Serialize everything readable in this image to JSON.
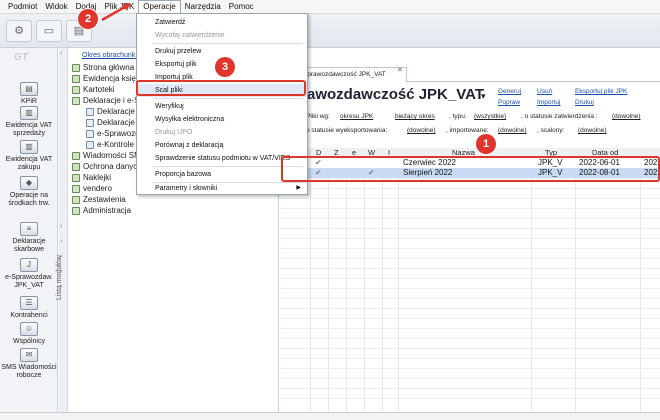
{
  "menubar": [
    "Podmiot",
    "Widok",
    "Dodaj",
    "Plik JPK",
    "Operacje",
    "Narzędzia",
    "Pomoc"
  ],
  "sidebar": {
    "items": [
      "KPiR",
      "Ewidencja VAT sprzedaży",
      "Ewidencja VAT zakupu",
      "Operacje na środkach trw.",
      "Deklaracje skarbowe",
      "e-Sprawozdaw. JPK_VAT",
      "Kontrahenci",
      "Wspólnicy",
      "SMS Wiadomości robocze"
    ],
    "modules_label": "Lista modułów"
  },
  "tree": {
    "period_link": "Okres obrachunk...",
    "items": [
      "Strona główna",
      "Ewidencja księg...",
      "Kartoteki",
      "Deklaracje i e-S...",
      "Deklaracje s...",
      "Deklaracje z...",
      "e-Sprawozd...",
      "e-Kontrole ...",
      "Wiadomości SM...",
      "Ochrona danyc...",
      "Naklejki",
      "vendero",
      "Zestawienia",
      "Administracja"
    ]
  },
  "main": {
    "tab_label": "sprawozdawczość JPK_VAT",
    "title": "Sprawozdawczość JPK_VAT",
    "actions": [
      "Generuj",
      "Usuń",
      "Eksportuj plik JPK",
      "Popraw",
      "Importuj",
      "Drukuj"
    ],
    "filters": {
      "by_label": "Pliki wg:",
      "by_value": "okresu JPK",
      "period_value": "bieżący okres",
      "type_label": ", typu:",
      "type_value": "(wszystkie)",
      "approval_label": ", o statusie zatwierdzenia :",
      "approval_value": "(dowolne)",
      "export_label": "o statusie wyeksportowania:",
      "export_value": "(dowolne)",
      "import_label": ", importowane:",
      "import_value": "(dowolne)",
      "merged_label": ", scalony:",
      "merged_value": "(dowolne)"
    }
  },
  "grid": {
    "headers": [
      "D",
      "Z",
      "e",
      "W",
      "I",
      "Nazwa",
      "Typ",
      "Data od"
    ],
    "rows": [
      {
        "name": "Czerwiec 2022",
        "type": "JPK_V",
        "date_from": "2022-06-01",
        "extra": "202"
      },
      {
        "name": "Sierpień 2022",
        "type": "JPK_V",
        "date_from": "2022-08-01",
        "extra": "202"
      }
    ]
  },
  "menu": {
    "items": [
      {
        "label": "Zatwierdź",
        "disabled": false
      },
      {
        "label": "Wycofaj zatwierdzenie",
        "disabled": true
      },
      {
        "label": "Drukuj przelew",
        "disabled": false
      },
      {
        "label": "Eksportuj plik",
        "disabled": false
      },
      {
        "label": "Importuj plik",
        "disabled": false
      },
      {
        "label": "Scal pliki",
        "disabled": false
      },
      {
        "label": "Weryfikuj",
        "disabled": false
      },
      {
        "label": "Wysyłka elektroniczna",
        "disabled": false
      },
      {
        "label": "Drukuj UPO",
        "disabled": true
      },
      {
        "label": "Porównaj z deklaracją",
        "disabled": false
      },
      {
        "label": "Sprawdzenie statusu podmiotu w VAT/VIES",
        "disabled": false
      },
      {
        "label": "Proporcja bazowa",
        "disabled": false
      },
      {
        "label": "Parametry i słowniki",
        "disabled": false
      }
    ]
  },
  "annotations": [
    "1",
    "2",
    "3"
  ],
  "colors": {
    "accent_red": "#e0352b",
    "link_blue": "#1a4fb0",
    "selected_row": "#c9dbf3"
  }
}
